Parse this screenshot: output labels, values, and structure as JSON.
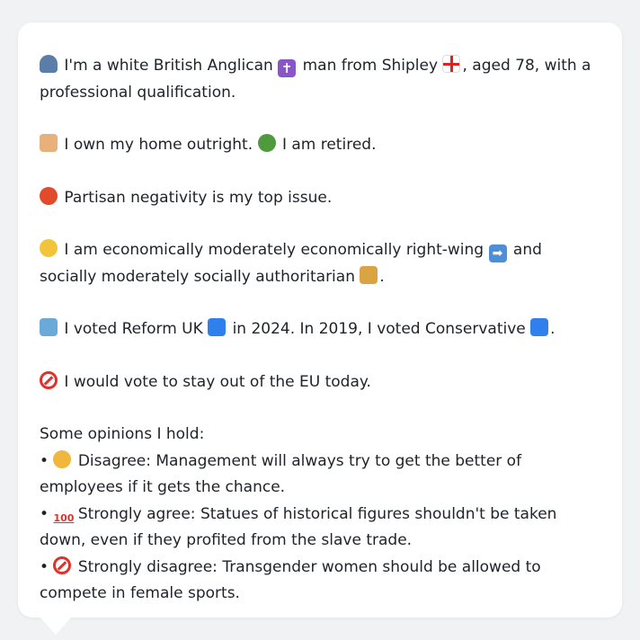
{
  "intro": {
    "pre": "I'm a white British Anglican",
    "mid": "man from Shipley",
    "post": ", aged 78, with a professional qualification."
  },
  "home": {
    "a": "I own my home outright.",
    "b": "I am retired."
  },
  "issue": "Partisan negativity is my top issue.",
  "ideology": {
    "a": "I am economically moderately economically right-wing",
    "b": "and socially moderately socially authoritarian",
    "c": "."
  },
  "vote": {
    "a": "I voted Reform UK",
    "b": "in 2024. In 2019, I voted Conservative",
    "c": "."
  },
  "eu": "I would vote to stay out of the EU today.",
  "opinions_heading": "Some opinions I hold:",
  "opinions": [
    {
      "bullet": "•",
      "text": "Disagree: Management will always try to get the better of employees if it gets the chance."
    },
    {
      "bullet": "•",
      "text": "Strongly agree: Statues of historical figures shouldn't be taken down, even if they profited from the slave trade."
    },
    {
      "bullet": "•",
      "text": "Strongly disagree: Transgender women should be allowed to compete in female sports."
    }
  ],
  "icons": {
    "cross_glyph": "✝",
    "arrow_glyph": "➡",
    "hundred_glyph": "100"
  },
  "colors": {
    "background": "#f1f2f4",
    "bubble": "#ffffff",
    "text": "#1f2328"
  }
}
